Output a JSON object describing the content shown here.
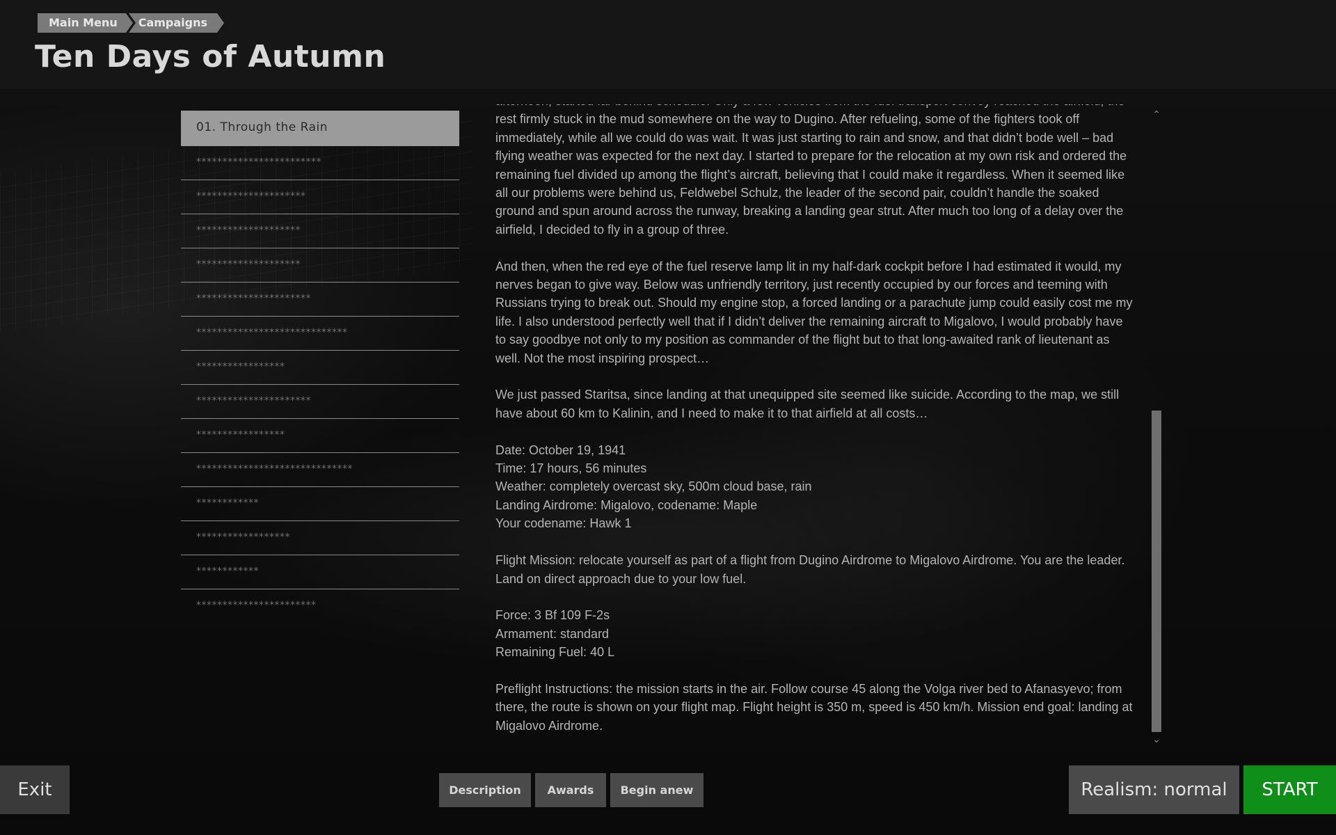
{
  "breadcrumb": {
    "items": [
      "Main Menu",
      "Campaigns"
    ]
  },
  "page_title": "Ten Days of Autumn",
  "missions": [
    {
      "label": "01. Through the Rain",
      "selected": true
    },
    {
      "label": "************************"
    },
    {
      "label": "*********************"
    },
    {
      "label": "********************"
    },
    {
      "label": "********************"
    },
    {
      "label": "**********************"
    },
    {
      "label": "*****************************"
    },
    {
      "label": "*****************"
    },
    {
      "label": "**********************"
    },
    {
      "label": "*****************"
    },
    {
      "label": "******************************"
    },
    {
      "label": "************"
    },
    {
      "label": "******************"
    },
    {
      "label": "************"
    },
    {
      "label": "***********************"
    }
  ],
  "description": {
    "paragraphs": [
      [
        "afternoon, started far behind schedule. Only a few vehicles from the fuel transport convoy reached the airfield, the",
        "rest firmly stuck in the mud somewhere on the way to Dugino. After refueling, some of the fighters took off",
        "immediately, while all we could do was wait. It was just starting to rain and snow, and that didn’t bode well – bad",
        "flying weather was expected for the next day. I started to prepare for the relocation at my own risk and ordered the",
        "remaining fuel divided up among the flight’s aircraft, believing that I could make it regardless. When it seemed like",
        "all our problems were behind us, Feldwebel Schulz, the leader of the second pair, couldn’t handle the soaked",
        "ground and spun around across the runway, breaking a landing gear strut. After much too long of a delay over the",
        "airfield, I decided to fly in a group of three."
      ],
      [
        "And then, when the red eye of the fuel reserve lamp lit in my half-dark cockpit before I had estimated it would, my",
        "nerves began to give way. Below was unfriendly territory, just recently occupied by our forces and teeming with",
        "Russians trying to break out. Should my engine stop, a forced landing or a parachute jump could easily cost me my",
        "life. I also understood perfectly well that if I didn’t deliver the remaining aircraft to Migalovo, I would probably have",
        "to say goodbye not only to my position as commander of the flight but to that long-awaited rank of lieutenant as",
        "well. Not the most inspiring prospect…"
      ],
      [
        "We just passed Staritsa, since landing at that unequipped site seemed like suicide. According to the map, we still",
        "have about 60 km to Kalinin, and I need to make it to that airfield at all costs…"
      ],
      [
        "Date: October 19, 1941",
        "Time: 17 hours, 56 minutes",
        "Weather: completely overcast sky, 500m cloud base, rain",
        "Landing Airdrome: Migalovo, codename: Maple",
        "Your codename: Hawk 1"
      ],
      [
        "Flight Mission: relocate yourself as part of a flight from Dugino Airdrome to Migalovo Airdrome. You are the leader.",
        "Land on direct approach due to your low fuel."
      ],
      [
        "Force: 3 Bf 109 F-2s",
        "Armament: standard",
        "Remaining Fuel: 40 L"
      ],
      [
        "Preflight Instructions: the mission starts in the air. Follow course 45 along the Volga river bed to Afanasyevo; from",
        "there, the route is shown on your flight map. Flight height is 350 m, speed is 450 km/h. Mission end goal: landing at",
        "Migalovo Airdrome."
      ]
    ]
  },
  "scroll": {
    "up_glyph": "⌃",
    "down_glyph": "⌄"
  },
  "buttons": {
    "exit": "Exit",
    "description": "Description",
    "awards": "Awards",
    "begin_anew": "Begin anew",
    "realism": "Realism: normal",
    "start": "START"
  },
  "colors": {
    "start": "#108e1a",
    "selected_mission": "#9b9b9b"
  }
}
